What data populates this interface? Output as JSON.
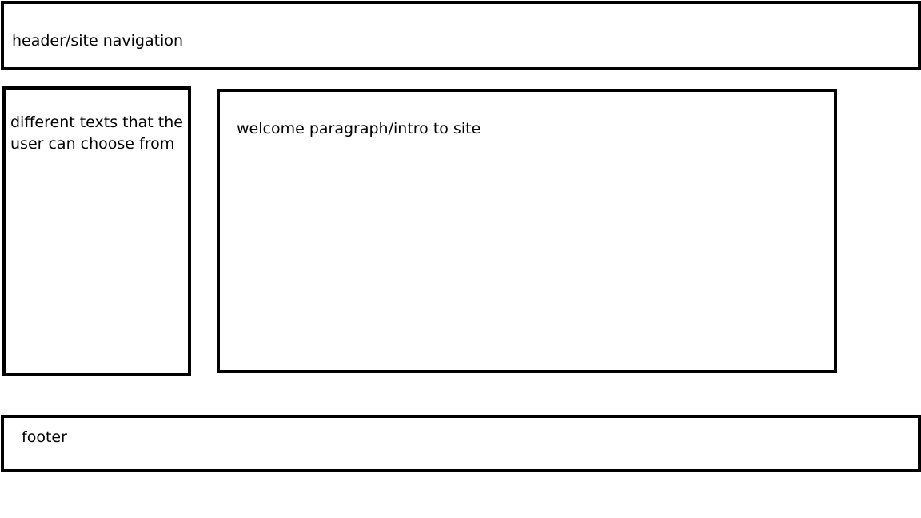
{
  "header": {
    "label": "header/site navigation"
  },
  "sidebar": {
    "label": "different texts that the user can choose from"
  },
  "main": {
    "label": "welcome paragraph/intro to site"
  },
  "footer": {
    "label": "footer"
  },
  "colors": {
    "stroke": "#000000",
    "background": "#ffffff"
  }
}
